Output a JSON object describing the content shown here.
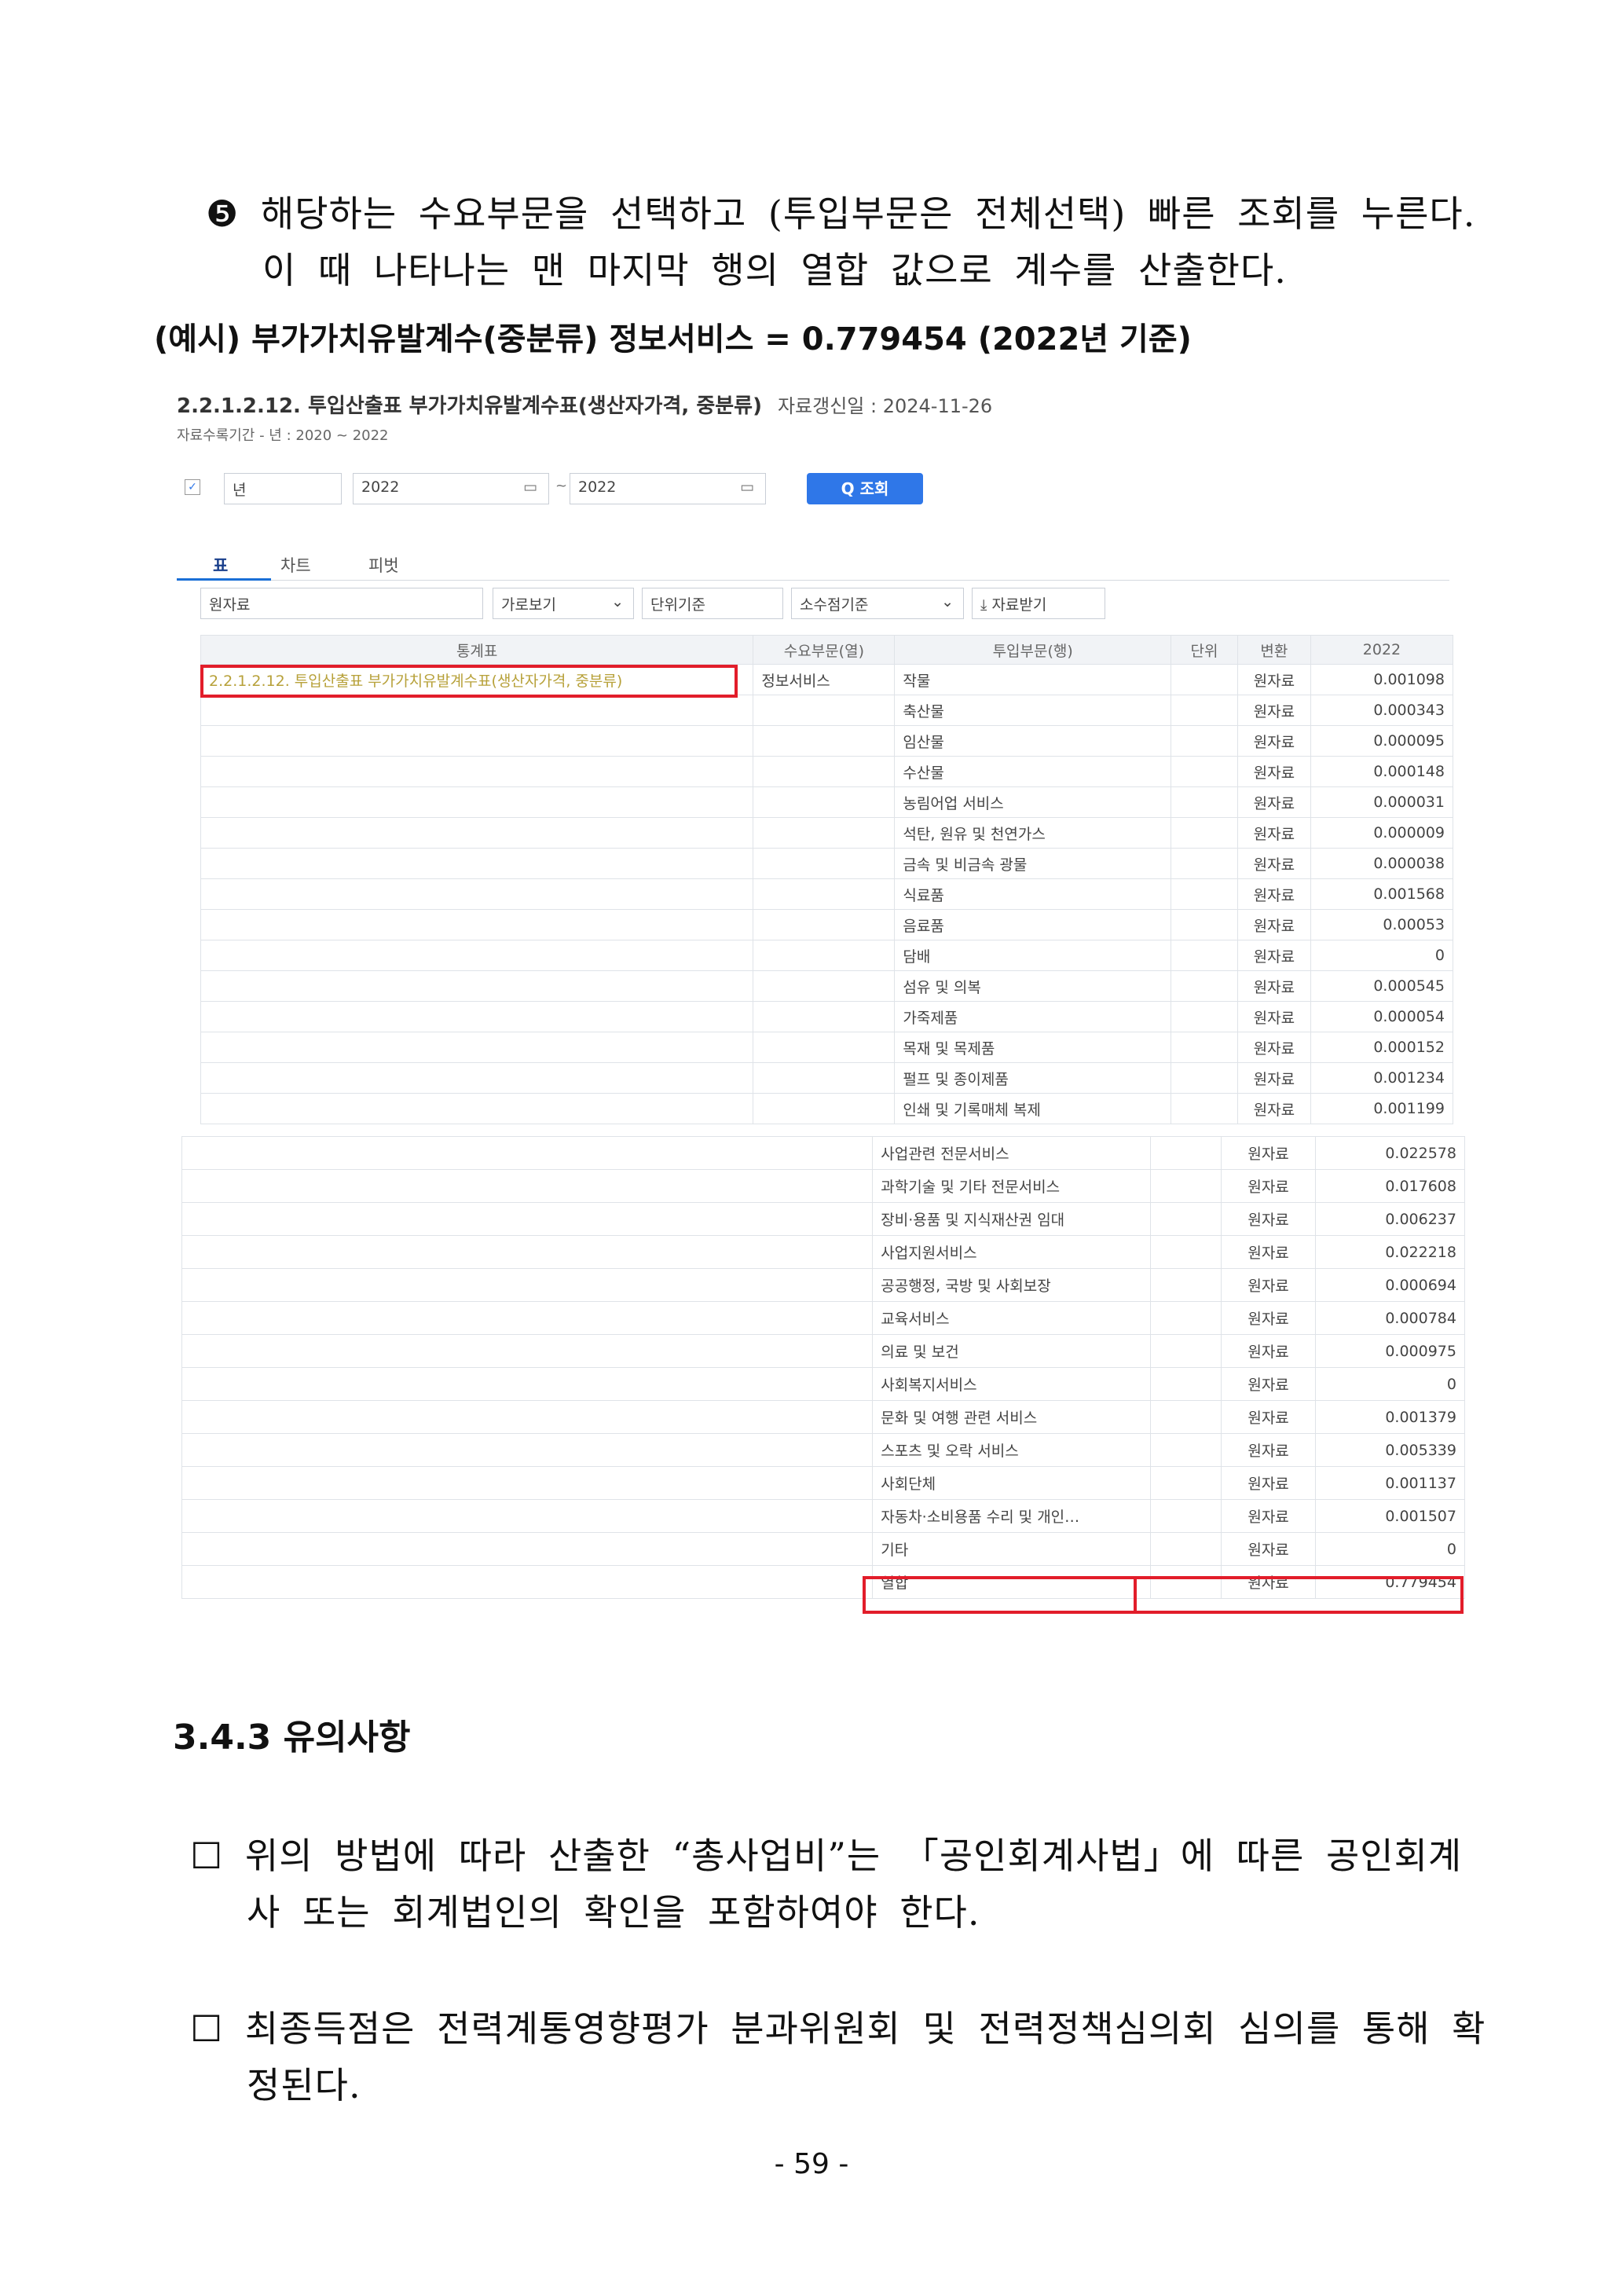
{
  "instruction": {
    "marker": "❺",
    "line1": "해당하는 수요부문을 선택하고 (투입부문은 전체선택) 빠른 조회를 누른다.",
    "line2": "이 때 나타나는 맨 마지막 행의 열합 값으로 계수를 산출한다."
  },
  "example": "(예시) 부가가치유발계수(중분류) 정보서비스 = 0.779454 (2022년 기준)",
  "screenshot": {
    "title": "2.2.1.2.12. 투입산출표 부가가치유발계수표(생산자가격, 중분류)",
    "updated": "자료갱신일 : 2024-11-26",
    "period": "자료수록기간 - 년 : 2020 ~ 2022",
    "filter": {
      "period_type": "년",
      "from": "2022",
      "to": "2022",
      "search_button": "Q 조회"
    },
    "tabs": [
      "표",
      "차트",
      "피벗"
    ],
    "toolbar": {
      "data_type": "원자료",
      "view": "가로보기",
      "unit": "단위기준",
      "decimal": "소수점기준",
      "download": "자료받기"
    },
    "headers": [
      "통계표",
      "수요부문(열)",
      "투입부문(행)",
      "단위",
      "변환",
      "2022"
    ],
    "table_name": "2.2.1.2.12. 투입산출표 부가가치유발계수표(생산자가격, 중분류)",
    "demand_sector": "정보서비스",
    "transform": "원자료",
    "rows_top": [
      {
        "sector": "작물",
        "value": "0.001098"
      },
      {
        "sector": "축산물",
        "value": "0.000343"
      },
      {
        "sector": "임산물",
        "value": "0.000095"
      },
      {
        "sector": "수산물",
        "value": "0.000148"
      },
      {
        "sector": "농림어업 서비스",
        "value": "0.000031"
      },
      {
        "sector": "석탄, 원유 및 천연가스",
        "value": "0.000009"
      },
      {
        "sector": "금속 및 비금속 광물",
        "value": "0.000038"
      },
      {
        "sector": "식료품",
        "value": "0.001568"
      },
      {
        "sector": "음료품",
        "value": "0.00053"
      },
      {
        "sector": "담배",
        "value": "0"
      },
      {
        "sector": "섬유 및 의복",
        "value": "0.000545"
      },
      {
        "sector": "가죽제품",
        "value": "0.000054"
      },
      {
        "sector": "목재 및 목제품",
        "value": "0.000152"
      },
      {
        "sector": "펄프 및 종이제품",
        "value": "0.001234"
      },
      {
        "sector": "인쇄 및 기록매체 복제",
        "value": "0.001199"
      }
    ],
    "rows_bottom": [
      {
        "sector": "사업관련 전문서비스",
        "value": "0.022578"
      },
      {
        "sector": "과학기술 및 기타 전문서비스",
        "value": "0.017608"
      },
      {
        "sector": "장비·용품 및 지식재산권 임대",
        "value": "0.006237"
      },
      {
        "sector": "사업지원서비스",
        "value": "0.022218"
      },
      {
        "sector": "공공행정, 국방 및 사회보장",
        "value": "0.000694"
      },
      {
        "sector": "교육서비스",
        "value": "0.000784"
      },
      {
        "sector": "의료 및 보건",
        "value": "0.000975"
      },
      {
        "sector": "사회복지서비스",
        "value": "0"
      },
      {
        "sector": "문화 및 여행 관련 서비스",
        "value": "0.001379"
      },
      {
        "sector": "스포츠 및 오락 서비스",
        "value": "0.005339"
      },
      {
        "sector": "사회단체",
        "value": "0.001137"
      },
      {
        "sector": "자동차·소비용품 수리 및 개인…",
        "value": "0.001507"
      },
      {
        "sector": "기타",
        "value": "0"
      },
      {
        "sector": "열합",
        "value": "0.779454"
      }
    ]
  },
  "section_heading": "3.4.3 유의사항",
  "notes": [
    {
      "box": "☐",
      "line1": "위의 방법에 따라 산출한 “총사업비”는 「공인회계사법」에 따른 공인회계",
      "line2": "사 또는 회계법인의 확인을 포함하여야 한다."
    },
    {
      "box": "☐",
      "line1": "최종득점은 전력계통영향평가 분과위원회 및 전력정책심의회 심의를 통해 확",
      "line2": "정된다."
    }
  ],
  "page_number": "- 59 -"
}
